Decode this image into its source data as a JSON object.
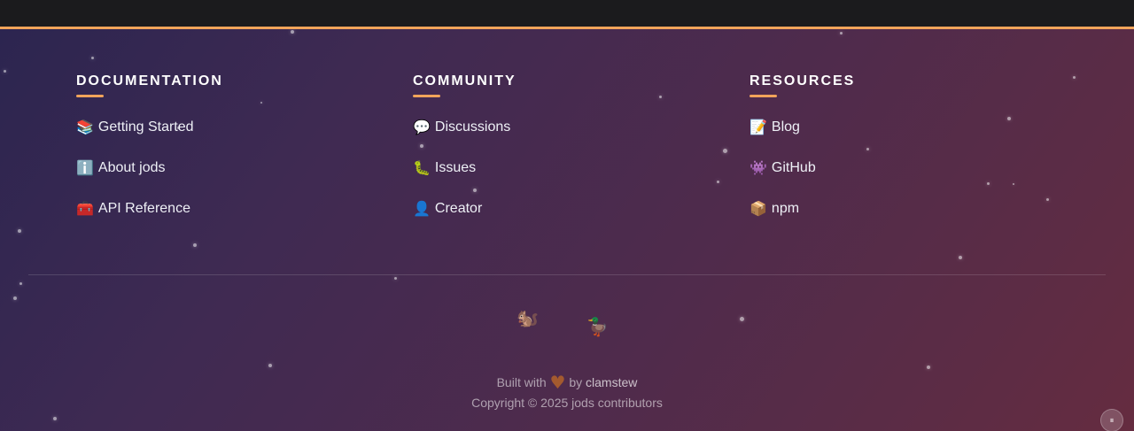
{
  "footer": {
    "columns": [
      {
        "title": "DOCUMENTATION",
        "links": [
          {
            "icon": "📚",
            "label": "Getting Started"
          },
          {
            "icon": "ℹ️",
            "label": "About jods"
          },
          {
            "icon": "🧰",
            "label": "API Reference"
          }
        ]
      },
      {
        "title": "COMMUNITY",
        "links": [
          {
            "icon": "💬",
            "label": "Discussions"
          },
          {
            "icon": "🐛",
            "label": "Issues"
          },
          {
            "icon": "👤",
            "label": "Creator"
          }
        ]
      },
      {
        "title": "RESOURCES",
        "links": [
          {
            "icon": "📝",
            "label": "Blog"
          },
          {
            "icon": "👾",
            "label": "GitHub"
          },
          {
            "icon": "📦",
            "label": "npm"
          }
        ]
      }
    ],
    "mascots": {
      "squirrel": "🐿️",
      "duck": "🦆"
    },
    "credit": {
      "built_with": "Built with",
      "heart": "♥",
      "by": "by",
      "author": "clamstew",
      "copyright": "Copyright © 2025 jods contributors"
    },
    "pause_icon": "⏸"
  },
  "colors": {
    "accent": "#f1a45a",
    "background_start": "#2c2550",
    "background_end": "#652c40",
    "topbar": "#1b1b1d"
  }
}
